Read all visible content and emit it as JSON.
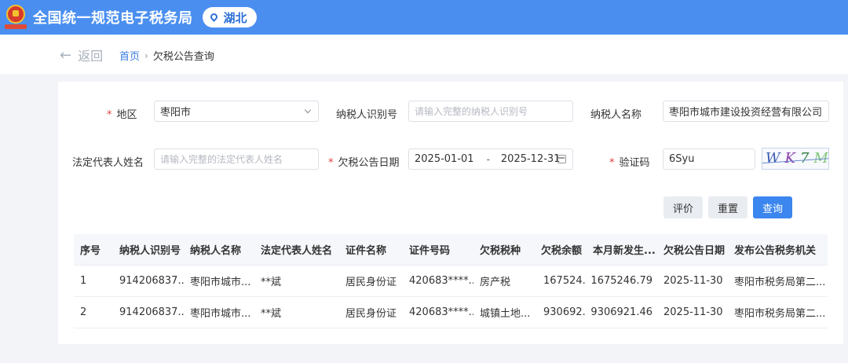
{
  "header": {
    "site_title": "全国统一规范电子税务局",
    "region": "湖北",
    "colors": {
      "header_bg": "#4a8ff0",
      "accent": "#3b86ef",
      "required": "#e0403a"
    }
  },
  "nav": {
    "back_label": "返回",
    "breadcrumb_home": "首页",
    "breadcrumb_current": "欠税公告查询"
  },
  "form": {
    "region_label": "地区",
    "region_value": "枣阳市",
    "taxpayer_id_label": "纳税人识别号",
    "taxpayer_id_placeholder": "请输入完整的纳税人识别号",
    "taxpayer_name_label": "纳税人名称",
    "taxpayer_name_value": "枣阳市城市建设投资经营有限公司",
    "legal_rep_label": "法定代表人姓名",
    "legal_rep_placeholder": "请输入完整的法定代表人姓名",
    "date_label": "欠税公告日期",
    "date_start": "2025-01-01",
    "date_sep": "-",
    "date_end": "2025-12-31",
    "captcha_label": "验证码",
    "captcha_value": "6Syu",
    "captcha_chars": [
      "W",
      "K",
      "7",
      "M"
    ]
  },
  "buttons": {
    "rate": "评价",
    "reset": "重置",
    "query": "查询"
  },
  "table": {
    "columns": [
      "序号",
      "纳税人识别号",
      "纳税人名称",
      "法定代表人姓名",
      "证件名称",
      "证件号码",
      "欠税税种",
      "欠税余额",
      "本月新发生...",
      "欠税公告日期",
      "发布公告税务机关"
    ],
    "rows": [
      [
        "1",
        "914206837...",
        "枣阳市城市...",
        "**斌",
        "居民身份证",
        "420683****...",
        "房产税",
        "167524...",
        "1675246.79",
        "2025-11-30",
        "枣阳市税务局第二..."
      ],
      [
        "2",
        "914206837...",
        "枣阳市城市...",
        "**斌",
        "居民身份证",
        "420683****...",
        "城镇土地...",
        "930692...",
        "9306921.46",
        "2025-11-30",
        "枣阳市税务局第二..."
      ]
    ]
  }
}
